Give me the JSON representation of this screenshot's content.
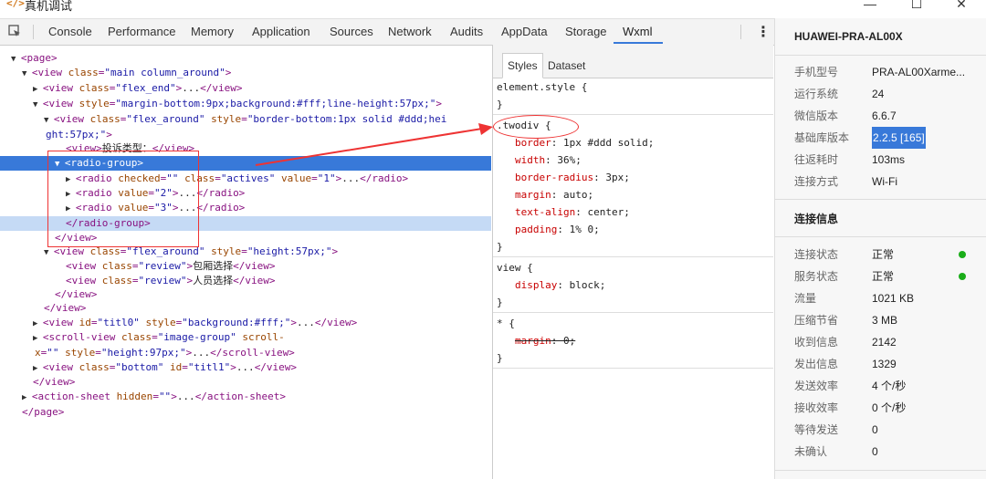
{
  "titlebar": {
    "title": "真机调试",
    "app_icon": "code-icon",
    "minimize": "—",
    "maximize": "☐",
    "close": "✕"
  },
  "toolbar": {
    "tabs": [
      "Console",
      "Performance",
      "Memory",
      "Application",
      "Sources",
      "Network",
      "Audits",
      "AppData",
      "Storage",
      "Wxml"
    ],
    "active_tab": "Wxml",
    "more_icon": "⋮"
  },
  "dom_lines": [
    {
      "i": 0,
      "tw": "▼",
      "parts": [
        [
          "tg",
          "<page>"
        ]
      ]
    },
    {
      "i": 1,
      "tw": "▼",
      "parts": [
        [
          "tg",
          "<view "
        ],
        [
          "an",
          "class"
        ],
        [
          "tg",
          "="
        ],
        [
          "av",
          "\"main column_around\""
        ],
        [
          "tg",
          ">"
        ]
      ]
    },
    {
      "i": 2,
      "tw": "▶",
      "parts": [
        [
          "tg",
          "<view "
        ],
        [
          "an",
          "class"
        ],
        [
          "tg",
          "="
        ],
        [
          "av",
          "\"flex_end\""
        ],
        [
          "tg",
          ">"
        ],
        [
          "tx",
          "..."
        ],
        [
          "tg",
          "</view>"
        ]
      ]
    },
    {
      "i": 2,
      "tw": "▼",
      "parts": [
        [
          "tg",
          "<view "
        ],
        [
          "an",
          "style"
        ],
        [
          "tg",
          "="
        ],
        [
          "av",
          "\"margin-bottom:9px;background:#fff;line-height:57px;\""
        ],
        [
          "tg",
          ">"
        ]
      ]
    },
    {
      "i": 3,
      "tw": "▼",
      "parts": [
        [
          "tg",
          "<view "
        ],
        [
          "an",
          "class"
        ],
        [
          "tg",
          "="
        ],
        [
          "av",
          "\"flex_around\""
        ],
        [
          "tg",
          " "
        ],
        [
          "an",
          "style"
        ],
        [
          "tg",
          "="
        ],
        [
          "av",
          "\"border-bottom:1px solid #ddd;hei"
        ]
      ]
    },
    {
      "i": -1,
      "tw": "",
      "parts": [
        [
          "av",
          "ght:57px;\""
        ],
        [
          "tg",
          ">"
        ]
      ]
    },
    {
      "i": 5,
      "tw": "",
      "parts": [
        [
          "tg",
          "<view>"
        ],
        [
          "tx",
          "投诉类型："
        ],
        [
          "tg",
          "</view>"
        ]
      ]
    },
    {
      "i": 4,
      "tw": "▼",
      "sel": true,
      "parts": [
        [
          "tg",
          "<radio-group>"
        ]
      ]
    },
    {
      "i": 5,
      "tw": "▶",
      "parts": [
        [
          "tg",
          "<radio "
        ],
        [
          "an",
          "checked"
        ],
        [
          "tg",
          "="
        ],
        [
          "av",
          "\"\""
        ],
        [
          "tg",
          " "
        ],
        [
          "an",
          "class"
        ],
        [
          "tg",
          "="
        ],
        [
          "av",
          "\"actives\""
        ],
        [
          "tg",
          " "
        ],
        [
          "an",
          "value"
        ],
        [
          "tg",
          "="
        ],
        [
          "av",
          "\"1\""
        ],
        [
          "tg",
          ">"
        ],
        [
          "tx",
          "..."
        ],
        [
          "tg",
          "</radio>"
        ]
      ]
    },
    {
      "i": 5,
      "tw": "▶",
      "parts": [
        [
          "tg",
          "<radio "
        ],
        [
          "an",
          "value"
        ],
        [
          "tg",
          "="
        ],
        [
          "av",
          "\"2\""
        ],
        [
          "tg",
          ">"
        ],
        [
          "tx",
          "..."
        ],
        [
          "tg",
          "</radio>"
        ]
      ]
    },
    {
      "i": 5,
      "tw": "▶",
      "parts": [
        [
          "tg",
          "<radio "
        ],
        [
          "an",
          "value"
        ],
        [
          "tg",
          "="
        ],
        [
          "av",
          "\"3\""
        ],
        [
          "tg",
          ">"
        ],
        [
          "tx",
          "..."
        ],
        [
          "tg",
          "</radio>"
        ]
      ]
    },
    {
      "i": 5,
      "tw": "",
      "hover": true,
      "parts": [
        [
          "tg",
          "</radio-group>"
        ]
      ]
    },
    {
      "i": 4,
      "tw": "",
      "parts": [
        [
          "tg",
          "</view>"
        ]
      ]
    },
    {
      "i": 3,
      "tw": "▼",
      "parts": [
        [
          "tg",
          "<view "
        ],
        [
          "an",
          "class"
        ],
        [
          "tg",
          "="
        ],
        [
          "av",
          "\"flex_around\""
        ],
        [
          "tg",
          " "
        ],
        [
          "an",
          "style"
        ],
        [
          "tg",
          "="
        ],
        [
          "av",
          "\"height:57px;\""
        ],
        [
          "tg",
          ">"
        ]
      ]
    },
    {
      "i": 5,
      "tw": "",
      "parts": [
        [
          "tg",
          "<view "
        ],
        [
          "an",
          "class"
        ],
        [
          "tg",
          "="
        ],
        [
          "av",
          "\"review\""
        ],
        [
          "tg",
          ">"
        ],
        [
          "tx",
          "包厢选择"
        ],
        [
          "tg",
          "</view>"
        ]
      ]
    },
    {
      "i": 5,
      "tw": "",
      "parts": [
        [
          "tg",
          "<view "
        ],
        [
          "an",
          "class"
        ],
        [
          "tg",
          "="
        ],
        [
          "av",
          "\"review\""
        ],
        [
          "tg",
          ">"
        ],
        [
          "tx",
          "人员选择"
        ],
        [
          "tg",
          "</view>"
        ]
      ]
    },
    {
      "i": 4,
      "tw": "",
      "parts": [
        [
          "tg",
          "</view>"
        ]
      ]
    },
    {
      "i": 3,
      "tw": "",
      "parts": [
        [
          "tg",
          "</view>"
        ]
      ]
    },
    {
      "i": 2,
      "tw": "▶",
      "parts": [
        [
          "tg",
          "<view "
        ],
        [
          "an",
          "id"
        ],
        [
          "tg",
          "="
        ],
        [
          "av",
          "\"titl0\""
        ],
        [
          "tg",
          " "
        ],
        [
          "an",
          "style"
        ],
        [
          "tg",
          "="
        ],
        [
          "av",
          "\"background:#fff;\""
        ],
        [
          "tg",
          ">"
        ],
        [
          "tx",
          "..."
        ],
        [
          "tg",
          "</view>"
        ]
      ]
    },
    {
      "i": 2,
      "tw": "▶",
      "parts": [
        [
          "tg",
          "<scroll-view "
        ],
        [
          "an",
          "class"
        ],
        [
          "tg",
          "="
        ],
        [
          "av",
          "\"image-group\""
        ],
        [
          "tg",
          " "
        ],
        [
          "an",
          "scroll-"
        ]
      ]
    },
    {
      "i": -2,
      "tw": "",
      "parts": [
        [
          "an",
          "x"
        ],
        [
          "tg",
          "="
        ],
        [
          "av",
          "\"\""
        ],
        [
          "tg",
          " "
        ],
        [
          "an",
          "style"
        ],
        [
          "tg",
          "="
        ],
        [
          "av",
          "\"height:97px;\""
        ],
        [
          "tg",
          ">"
        ],
        [
          "tx",
          "..."
        ],
        [
          "tg",
          "</scroll-view>"
        ]
      ]
    },
    {
      "i": 2,
      "tw": "▶",
      "parts": [
        [
          "tg",
          "<view "
        ],
        [
          "an",
          "class"
        ],
        [
          "tg",
          "="
        ],
        [
          "av",
          "\"bottom\""
        ],
        [
          "tg",
          " "
        ],
        [
          "an",
          "id"
        ],
        [
          "tg",
          "="
        ],
        [
          "av",
          "\"titl1\""
        ],
        [
          "tg",
          ">"
        ],
        [
          "tx",
          "..."
        ],
        [
          "tg",
          "</view>"
        ]
      ]
    },
    {
      "i": 2,
      "tw": "",
      "parts": [
        [
          "tg",
          "</view>"
        ]
      ]
    },
    {
      "i": 1,
      "tw": "▶",
      "parts": [
        [
          "tg",
          "<action-sheet "
        ],
        [
          "an",
          "hidden"
        ],
        [
          "tg",
          "="
        ],
        [
          "av",
          "\"\""
        ],
        [
          "tg",
          ">"
        ],
        [
          "tx",
          "..."
        ],
        [
          "tg",
          "</action-sheet>"
        ]
      ]
    },
    {
      "i": 1,
      "tw": "",
      "parts": [
        [
          "tg",
          "</page>"
        ]
      ]
    }
  ],
  "styles_panel": {
    "tabs": [
      "Styles",
      "Dataset"
    ],
    "active_tab": "Styles",
    "blocks": [
      {
        "selector": "element.style {",
        "decls": [],
        "close": "}"
      },
      {
        "selector": ".twodiv {",
        "decls": [
          [
            "border",
            "1px #ddd solid;"
          ],
          [
            "width",
            "36%;"
          ],
          [
            "border-radius",
            "3px;"
          ],
          [
            "margin",
            "auto;"
          ],
          [
            "text-align",
            "center;"
          ],
          [
            "padding",
            "1% 0;"
          ]
        ],
        "close": "}"
      },
      {
        "selector": "view {",
        "decls": [
          [
            "display",
            "block;"
          ]
        ],
        "close": "}"
      },
      {
        "selector": "* {",
        "decls": [
          [
            "margin",
            "0;"
          ]
        ],
        "struck": true,
        "close": "}"
      }
    ]
  },
  "device": {
    "name": "HUAWEI-PRA-AL00X",
    "info": [
      {
        "label": "手机型号",
        "value": "PRA-AL00Xarme..."
      },
      {
        "label": "运行系统",
        "value": "24"
      },
      {
        "label": "微信版本",
        "value": "6.6.7"
      },
      {
        "label": "基础库版本",
        "value": "2.2.5 [165]",
        "highlight": true
      },
      {
        "label": "往返耗时",
        "value": "103ms"
      },
      {
        "label": "连接方式",
        "value": "Wi-Fi"
      }
    ],
    "conn_title": "连接信息",
    "conn": [
      {
        "label": "连接状态",
        "value": "正常",
        "dot": true
      },
      {
        "label": "服务状态",
        "value": "正常",
        "dot": true
      },
      {
        "label": "流量",
        "value": "1021 KB"
      },
      {
        "label": "压缩节省",
        "value": "3 MB"
      },
      {
        "label": "收到信息",
        "value": "2142"
      },
      {
        "label": "发出信息",
        "value": "1329"
      },
      {
        "label": "发送效率",
        "value": "4 个/秒"
      },
      {
        "label": "接收效率",
        "value": "0 个/秒"
      },
      {
        "label": "等待发送",
        "value": "0"
      },
      {
        "label": "未确认",
        "value": "0"
      }
    ],
    "status_color": "#1aad19"
  },
  "accent_color": "#3879d9",
  "annotation_color": "#e33333"
}
